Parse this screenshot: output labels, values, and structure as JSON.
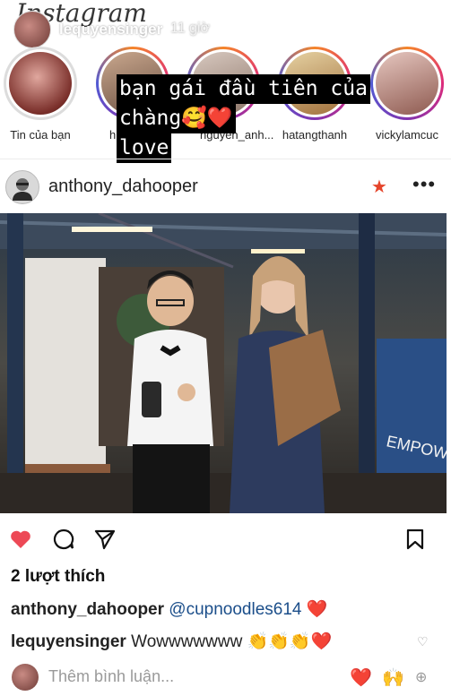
{
  "story_overlay": {
    "app_logo": "Instagram",
    "username": "lequyensinger",
    "time_ago": "11 giờ",
    "sticker_lines": [
      "bạn gái đầu tiên của",
      "chàng🥰❤️",
      "love"
    ]
  },
  "stories": [
    {
      "label": "Tin của bạn",
      "own": true
    },
    {
      "label": "h",
      "own": false
    },
    {
      "label": "nguyen_anh...",
      "own": false
    },
    {
      "label": "hatangthanh",
      "own": false
    },
    {
      "label": "vickylamcuc",
      "own": false
    }
  ],
  "post": {
    "author": "anthony_dahooper",
    "star_icon": "star-icon",
    "more_icon": "more-icon",
    "photo_sign_text": "EMPOWE",
    "likes": "2 lượt thích",
    "caption": {
      "user": "anthony_dahooper",
      "mention": "@cupnoodles614",
      "emoji": "❤️"
    },
    "comment": {
      "user": "lequyensinger",
      "text": "Wowwwwwww",
      "emoji": "👏👏👏❤️"
    },
    "add_comment_placeholder": "Thêm bình luận...",
    "quick_reactions": [
      "❤️",
      "🙌"
    ]
  },
  "colors": {
    "like_red": "#ed4956",
    "link_blue": "#1b4e8a",
    "star_orange": "#e5452b"
  }
}
